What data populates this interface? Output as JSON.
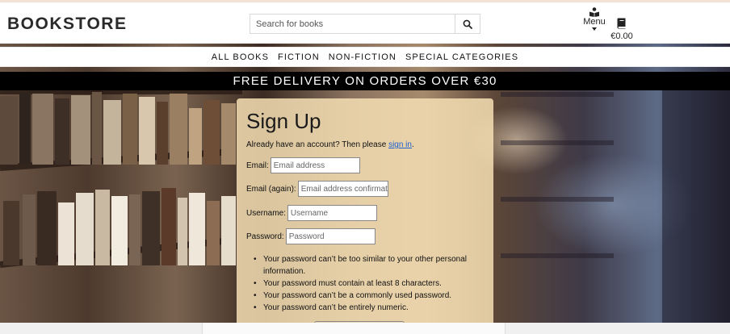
{
  "header": {
    "logo": "BOOKSTORE",
    "search_placeholder": "Search for books",
    "menu_label": "Menu",
    "cart_total": "€0.00"
  },
  "nav": {
    "items": [
      "ALL BOOKS",
      "FICTION",
      "NON-FICTION",
      "SPECIAL CATEGORIES"
    ]
  },
  "banner": {
    "text": "FREE DELIVERY ON ORDERS OVER €30"
  },
  "signup": {
    "title": "Sign Up",
    "lead_text": "Already have an account? Then please ",
    "signin_link": "sign in",
    "lead_end": ".",
    "fields": [
      {
        "label": "Email:",
        "placeholder": "Email address"
      },
      {
        "label": "Email (again):",
        "placeholder": "Email address confirmation"
      },
      {
        "label": "Username:",
        "placeholder": "Username"
      },
      {
        "label": "Password:",
        "placeholder": "Password"
      }
    ],
    "password_rules": [
      "Your password can’t be too similar to your other personal information.",
      "Your password must contain at least 8 characters.",
      "Your password can’t be a commonly used password.",
      "Your password can’t be entirely numeric."
    ]
  },
  "icons": {
    "search": "search-icon",
    "menu": "reader-icon",
    "cart": "book-icon"
  }
}
